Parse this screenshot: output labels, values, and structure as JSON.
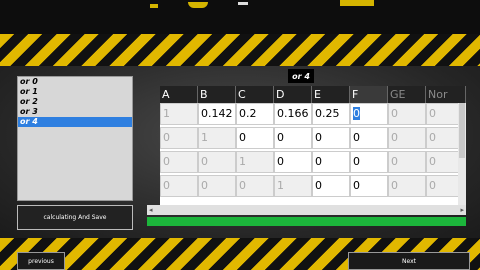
{
  "list": {
    "items": [
      "or 0",
      "or 1",
      "or 2",
      "or 3",
      "or 4"
    ],
    "selected_index": 4
  },
  "tag": "or 4",
  "table": {
    "headers": [
      "A",
      "B",
      "C",
      "D",
      "E",
      "F",
      "GE",
      "Nor"
    ],
    "rows": [
      [
        "1",
        "0.142",
        "0.2",
        "0.166",
        "0.25",
        "0",
        "0",
        "0"
      ],
      [
        "0",
        "1",
        "0",
        "0",
        "0",
        "0",
        "0",
        "0"
      ],
      [
        "0",
        "0",
        "1",
        "0",
        "0",
        "0",
        "0",
        "0"
      ],
      [
        "0",
        "0",
        "0",
        "1",
        "0",
        "0",
        "0",
        "0"
      ]
    ]
  },
  "buttons": {
    "calc": "calculating And Save",
    "previous": "previous",
    "next": "Next"
  },
  "progress": {
    "value": 1.0
  },
  "colors": {
    "accent": "#2e7fe0",
    "hazard": "#e1b800",
    "progress": "#1cb53b"
  }
}
